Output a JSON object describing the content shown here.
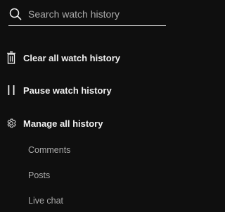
{
  "search": {
    "placeholder": "Search watch history",
    "value": "",
    "icon": "search-icon"
  },
  "actions": [
    {
      "label": "Clear all watch history",
      "icon": "trash-icon"
    },
    {
      "label": "Pause watch history",
      "icon": "pause-icon"
    },
    {
      "label": "Manage all history",
      "icon": "gear-icon"
    }
  ],
  "manage_subitems": [
    {
      "label": "Comments"
    },
    {
      "label": "Posts"
    },
    {
      "label": "Live chat"
    }
  ],
  "colors": {
    "background": "#0f0f0f",
    "text_primary": "#f1f1f1",
    "text_secondary": "#aaaaaa"
  }
}
